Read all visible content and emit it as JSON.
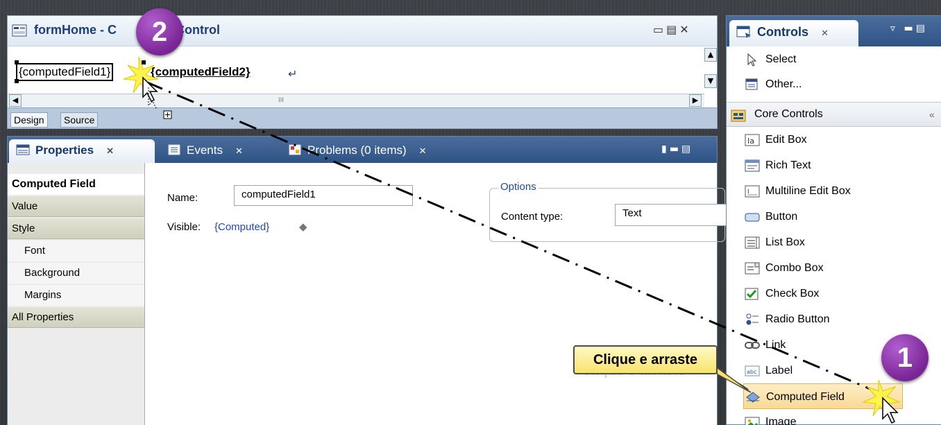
{
  "editor": {
    "title": "formHome - C",
    "title_tail": "Control",
    "field1": "{computedField1}",
    "field2": "{computedField2}",
    "para_mark": "↵",
    "tabs": {
      "design": "Design",
      "source": "Source"
    },
    "scroll_grip": "III"
  },
  "properties_panel": {
    "tabs": {
      "properties": "Properties",
      "events": "Events",
      "problems": "Problems (0 items)"
    },
    "nav": {
      "current": "Computed Field",
      "value": "Value",
      "style": "Style",
      "font": "Font",
      "background": "Background",
      "margins": "Margins",
      "all": "All Properties"
    },
    "name_label": "Name:",
    "name_value": "computedField1",
    "visible_label": "Visible:",
    "visible_value": "{Computed}",
    "visible_marker": "◆",
    "options": {
      "legend": "Options",
      "content_type_label": "Content type:",
      "content_type_value": "Text"
    }
  },
  "palette": {
    "tab_title": "Controls",
    "select": "Select",
    "other": "Other...",
    "core_header": "Core Controls",
    "core_collapse": "«",
    "items": [
      "Edit Box",
      "Rich Text",
      "Multiline Edit Box",
      "Button",
      "List Box",
      "Combo Box",
      "Check Box",
      "Radio Button",
      "Link",
      "Label",
      "Computed Field",
      "Image"
    ]
  },
  "overlay": {
    "badge1": "1",
    "badge2": "2",
    "callout": "Clique e arraste",
    "callout_shadow": "Clique e arraste"
  },
  "colors": {
    "accent": "#2f5386",
    "badge": "#8a2fa8",
    "callout": "#f7e36a",
    "highlight": "#f8d996"
  }
}
